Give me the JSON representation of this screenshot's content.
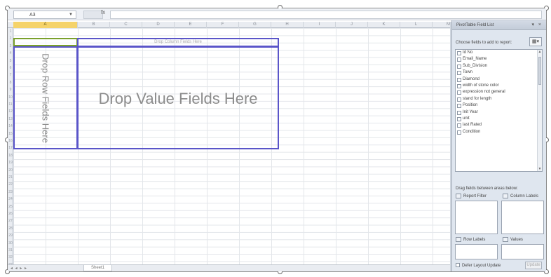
{
  "formula_bar": {
    "name_box": "A3",
    "fx_label": "fx",
    "formula": ""
  },
  "columns": [
    "A",
    "B",
    "C",
    "D",
    "E",
    "F",
    "G",
    "H",
    "I",
    "J",
    "K",
    "L",
    "M"
  ],
  "active_column": "A",
  "rows": [
    "1",
    "2",
    "3",
    "4",
    "5",
    "6",
    "7",
    "8",
    "9",
    "10",
    "11",
    "12",
    "13",
    "14",
    "15",
    "16",
    "17",
    "18",
    "19",
    "20",
    "21",
    "22",
    "23",
    "24",
    "25",
    "26",
    "27",
    "28",
    "29",
    "30",
    "31",
    "32",
    "33"
  ],
  "pivot": {
    "column_drop": "Drop Column Fields Here",
    "row_drop": "Drop Row Fields Here",
    "value_drop": "Drop Value Fields Here"
  },
  "sheet_bar": {
    "nav_arrows": "◂ ◂ ▸ ▸",
    "tab": "Sheet1"
  },
  "pane": {
    "title": "PivotTable Field List",
    "controls": "▾ ×",
    "choose_label": "Choose fields to add to report:",
    "layout_button": "▦▾",
    "fields": [
      "Id No",
      "Email_Name",
      "Sub_Division",
      "Town",
      "Diamond",
      "width of stone color",
      "expression not general",
      "stand for length",
      "Position",
      "Init Year",
      "unit",
      "last Rated",
      "Condition"
    ],
    "drag_label": "Drag fields between areas below:",
    "areas": {
      "report_filter": "Report Filter",
      "column_labels": "Column Labels",
      "row_labels": "Row Labels",
      "values": "Values"
    },
    "defer_label": "Defer Layout Update",
    "update_button": "Update"
  }
}
